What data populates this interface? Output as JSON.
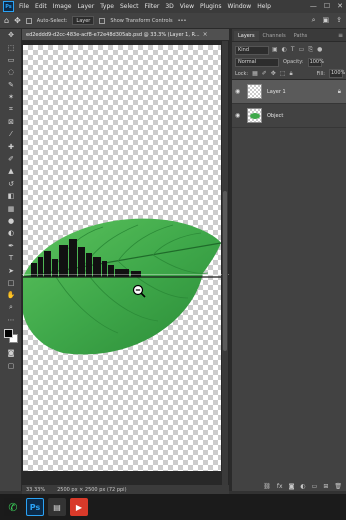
{
  "app": {
    "logo_text": "Ps"
  },
  "menu": [
    "File",
    "Edit",
    "Image",
    "Layer",
    "Type",
    "Select",
    "Filter",
    "3D",
    "View",
    "Plugins",
    "Window",
    "Help"
  ],
  "window_controls": [
    "—",
    "☐",
    "✕"
  ],
  "options_bar": {
    "auto_select_label": "Auto-Select:",
    "auto_select_value": "Layer",
    "show_transform_label": "Show Transform Controls",
    "more_label": "•••"
  },
  "document": {
    "tab_title": "ed2eddd9-d2cc-483e-acf8-e72e48d305ab.psd @ 33.3% (Layer 1, R...",
    "close_glyph": "×"
  },
  "status_bar": {
    "zoom": "33.33%",
    "doc_info": "2500 px × 2500 px (72 ppi)"
  },
  "layers_panel": {
    "tabs": [
      "Layers",
      "Channels",
      "Paths"
    ],
    "active_tab": 0,
    "kind_label": "Kind",
    "blend_mode": "Normal",
    "opacity_label": "Opacity:",
    "opacity_value": "100%",
    "lock_label": "Lock:",
    "fill_label": "Fill:",
    "fill_value": "100%",
    "layers": [
      {
        "name": "Layer 1",
        "selected": true,
        "locked": true
      },
      {
        "name": "Object",
        "selected": false,
        "locked": false
      }
    ]
  },
  "taskbar": {
    "apps": [
      "whatsapp",
      "photoshop",
      "files",
      "media"
    ]
  },
  "colors": {
    "leaf_green": "#3fa84a",
    "leaf_dark": "#1f6b2a",
    "accent": "#2ba3f5"
  }
}
